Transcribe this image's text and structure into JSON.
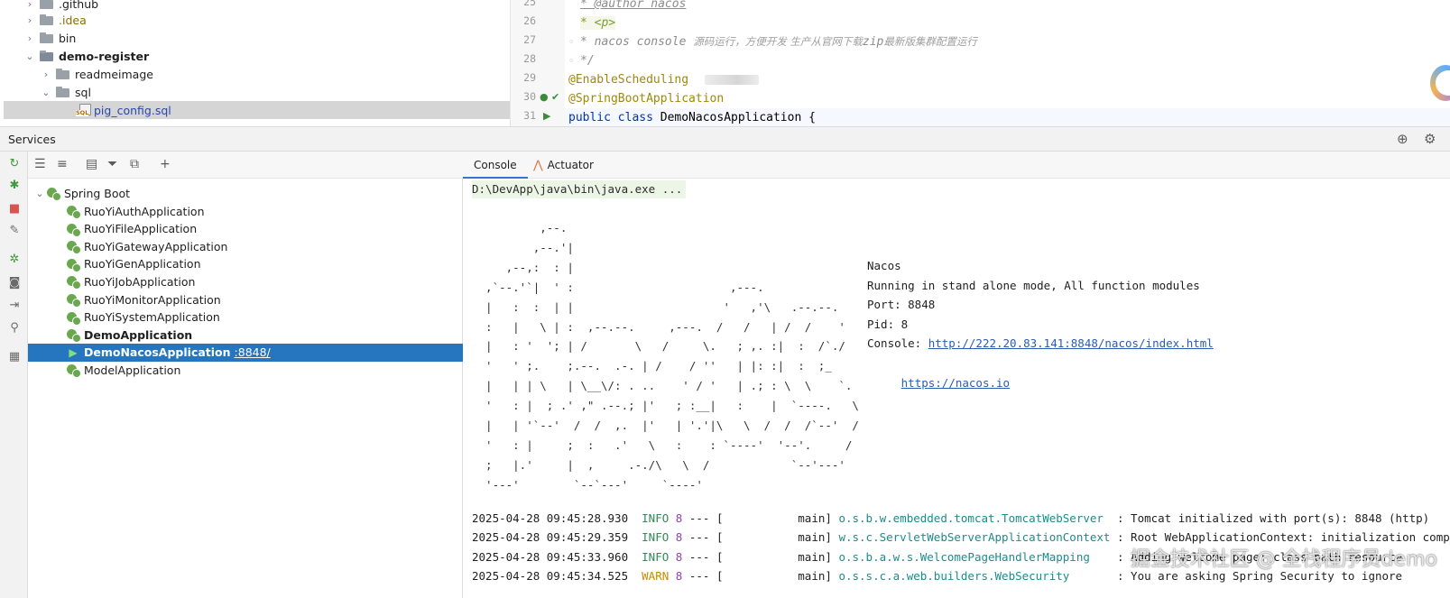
{
  "project_tree": {
    "items": [
      {
        "label": ".github",
        "kind": "folder",
        "arrow": "›"
      },
      {
        "label": ".idea",
        "kind": "folder",
        "arrow": "›"
      },
      {
        "label": "bin",
        "kind": "folder",
        "arrow": "›"
      },
      {
        "label": "demo-register",
        "kind": "module",
        "arrow": "⌄"
      },
      {
        "label": "readmeimage",
        "kind": "folder",
        "arrow": "›"
      },
      {
        "label": "sql",
        "kind": "folder",
        "arrow": "⌄"
      },
      {
        "label": "pig_config.sql",
        "kind": "sql-file",
        "badge": "SQL"
      }
    ]
  },
  "editor": {
    "lines": [
      {
        "num": "25",
        "text": " * @author nacos"
      },
      {
        "num": "26",
        "text": " * <p>"
      },
      {
        "num": "27",
        "prefix": " * nacos console ",
        "cn": "源码运行，方便开发 生产从官网下载",
        "mid": "zip",
        "cn2": "最新版集群配置运行"
      },
      {
        "num": "28",
        "text": " */"
      },
      {
        "num": "29",
        "text": "@EnableScheduling"
      },
      {
        "num": "30",
        "text": "@SpringBootApplication"
      },
      {
        "num": "31",
        "kw": "public class ",
        "cls": "DemoNacosApplication {"
      }
    ]
  },
  "services": {
    "title": "Services",
    "root_label": "Spring Boot",
    "apps": [
      {
        "name": "RuoYiAuthApplication"
      },
      {
        "name": "RuoYiFileApplication"
      },
      {
        "name": "RuoYiGatewayApplication"
      },
      {
        "name": "RuoYiGenApplication"
      },
      {
        "name": "RuoYiJobApplication"
      },
      {
        "name": "RuoYiMonitorApplication"
      },
      {
        "name": "RuoYiSystemApplication"
      },
      {
        "name": "DemoApplication"
      },
      {
        "name": "DemoNacosApplication",
        "port": ":8848/"
      },
      {
        "name": "ModelApplication"
      }
    ]
  },
  "console": {
    "tabs": {
      "console": "Console",
      "actuator": "Actuator"
    },
    "command": "D:\\DevApp\\java\\bin\\java.exe ...",
    "ascii_art": "          ,--.\n         ,--.'|\n     ,--,:  : |                                 \n  ,`--.'`|  ' :                       ,---.     \n  |   :  :  | |                      '   ,'\\   .--.--.\n  :   |   \\ | :  ,--.--.     ,---.  /   /   | /  /    '\n  |   : '  '; | /       \\   /     \\.   ; ,. :|  :  /`./\n  '   ' ;.    ;.--.  .-. | /    / ''   | |: :|  :  ;_\n  |   | | \\   | \\__\\/: . ..    ' / '   | .; : \\  \\    `.\n  '   : |  ; .' ,\" .--.; |'   ; :__|   :    |  `----.   \\\n  |   | '`--'  /  /  ,.  |'   | '.'|\\   \\  /  /  /`--'  /\n  '   : |     ;  :   .'   \\   :    : `----'  '--'.     /\n  ;   |.'     |  ,     .-./\\   \\  /            `--'---'\n  '---'        `--`---'     `----'",
    "nacos_info": {
      "name": "Nacos",
      "mode": "Running in stand alone mode, All function modules",
      "port": "Port: 8848",
      "pid": "Pid: 8",
      "console_label": "Console: ",
      "console_url": "http://222.20.83.141:8848/nacos/index.html",
      "site_url": "https://nacos.io"
    },
    "logs": [
      {
        "ts": "2025-04-28 09:45:28.930",
        "level": "INFO",
        "pid": "8",
        "sep": " --- [",
        "thread": "           main]",
        "logger": "o.s.b.w.embedded.tomcat.TomcatWebServer ",
        "msg": " : Tomcat initialized with port(s): 8848 (http)"
      },
      {
        "ts": "2025-04-28 09:45:29.359",
        "level": "INFO",
        "pid": "8",
        "sep": " --- [",
        "thread": "           main]",
        "logger": "w.s.c.ServletWebServerApplicationContext",
        "msg": " : Root WebApplicationContext: initialization completed"
      },
      {
        "ts": "2025-04-28 09:45:33.960",
        "level": "INFO",
        "pid": "8",
        "sep": " --- [",
        "thread": "           main]",
        "logger": "o.s.b.a.w.s.WelcomePageHandlerMapping   ",
        "msg": " : Adding welcome page: class path resource"
      },
      {
        "ts": "2025-04-28 09:45:34.525",
        "level": "WARN",
        "pid": "8",
        "sep": " --- [",
        "thread": "           main]",
        "logger": "o.s.s.c.a.web.builders.WebSecurity      ",
        "msg": " : You are asking Spring Security to ignore"
      }
    ]
  },
  "watermark": "掘金技术社区 @ 全栈程序员demo"
}
